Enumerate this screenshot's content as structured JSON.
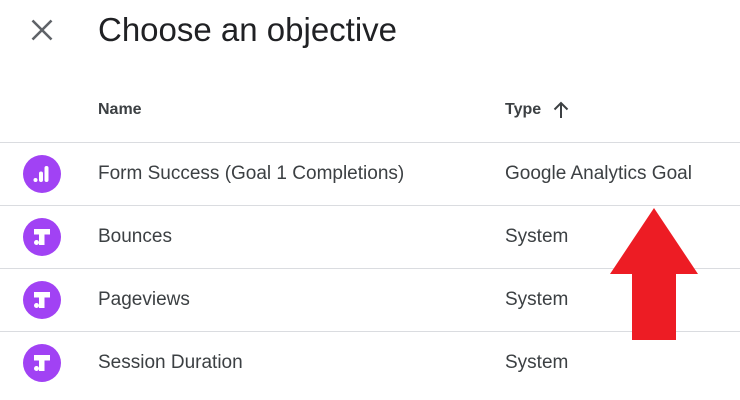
{
  "dialog": {
    "title": "Choose an objective",
    "close_icon": "close-icon"
  },
  "table": {
    "columns": {
      "name": "Name",
      "type": "Type",
      "sort_icon": "arrow-up-icon"
    },
    "rows": [
      {
        "icon": "analytics-bars-icon",
        "name": "Form Success (Goal 1 Completions)",
        "type": "Google Analytics Goal"
      },
      {
        "icon": "optimize-icon",
        "name": "Bounces",
        "type": "System"
      },
      {
        "icon": "optimize-icon",
        "name": "Pageviews",
        "type": "System"
      },
      {
        "icon": "optimize-icon",
        "name": "Session Duration",
        "type": "System"
      }
    ]
  },
  "colors": {
    "icon_purple": "#a142f4",
    "divider": "#dadce0",
    "annotation_arrow": "#ed1c24"
  }
}
